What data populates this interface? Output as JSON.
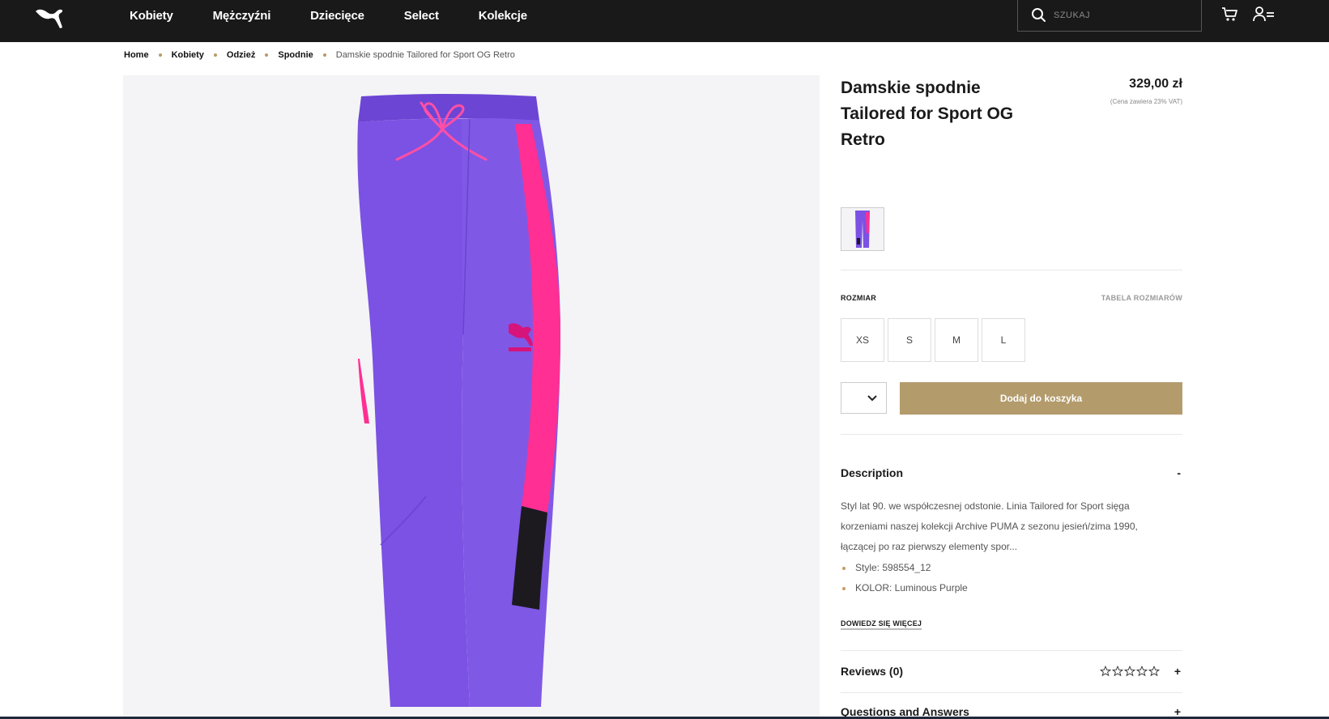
{
  "nav": {
    "items": [
      "Kobiety",
      "Mężczyźni",
      "Dziecięce",
      "Select",
      "Kolekcje"
    ],
    "search_placeholder": "SZUKAJ"
  },
  "breadcrumb": {
    "items": [
      "Home",
      "Kobiety",
      "Odzież",
      "Spodnie"
    ],
    "current": "Damskie spodnie Tailored for Sport OG Retro"
  },
  "product": {
    "title": "Damskie spodnie Tailored for Sport OG Retro",
    "price": "329,00 zł",
    "vat_note": "(Cena zawiera 23% VAT)",
    "size_label": "ROZMIAR",
    "size_chart_label": "TABELA ROZMIARÓW",
    "sizes": [
      "XS",
      "S",
      "M",
      "L"
    ],
    "add_to_cart": "Dodaj do koszyka"
  },
  "description": {
    "heading": "Description",
    "toggle": "-",
    "text": "Styl lat 90. we współczesnej odstonie. Linia Tailored for Sport sięga korzeniami naszej kolekcji Archive PUMA z sezonu jesień/zima 1990, łączącej po raz pierwszy elementy spor...",
    "bullets": [
      "Style: 598554_12",
      "KOLOR: Luminous Purple"
    ],
    "more_link": "DOWIEDZ SIĘ WIĘCEJ"
  },
  "reviews": {
    "heading": "Reviews (0)",
    "rating": 0,
    "max_rating": 5,
    "toggle": "+"
  },
  "qa": {
    "heading": "Questions and Answers",
    "toggle": "+"
  },
  "colors": {
    "topbar": "#191919",
    "accent_gold": "#b39b6c",
    "pants_purple": "#7b4fe0",
    "stripe_pink": "#ff2f93"
  }
}
